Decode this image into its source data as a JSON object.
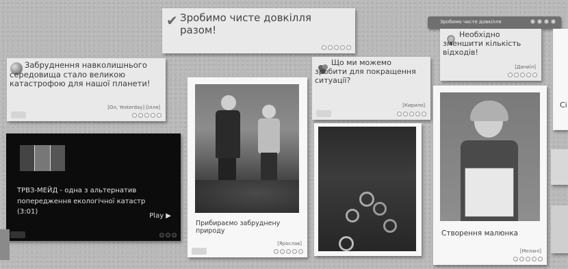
{
  "notes": {
    "top_center": {
      "text": "Зробимо чисте довкілля разом!"
    },
    "left": {
      "text": "Забруднення навколишнього середовища стало великою катастрофою для нашої планети!",
      "meta": "[Ол, Yesterday] [Ілля]"
    },
    "middle": {
      "text": "Що ми можемо зробити для покращення ситуації?",
      "author": "[Кирило]"
    },
    "right": {
      "text": "Необхідно зменшити кількість відходів!",
      "author": "[Даниїл]"
    },
    "far_right_fragment": {
      "text": "Сі"
    }
  },
  "video": {
    "title": "ТРВЗ-МЕЙД - одна з альтернатив попередження екологічної катастр (3:01)",
    "play_label": "Play ▶"
  },
  "photos": {
    "cleanup": {
      "caption": "Прибираємо забруднену природу",
      "author": "[Ярослав]"
    },
    "drawing": {
      "caption": "Створення малюнка",
      "author": "[Мелані]"
    }
  },
  "header_widget": {
    "text": "Зробимо чисте довкілля"
  },
  "icons": {
    "check": "checkmark-icon",
    "globe": "globe-icon",
    "cluster": "cluster-icon",
    "bulb": "lightbulb-icon",
    "play": "play-icon"
  }
}
